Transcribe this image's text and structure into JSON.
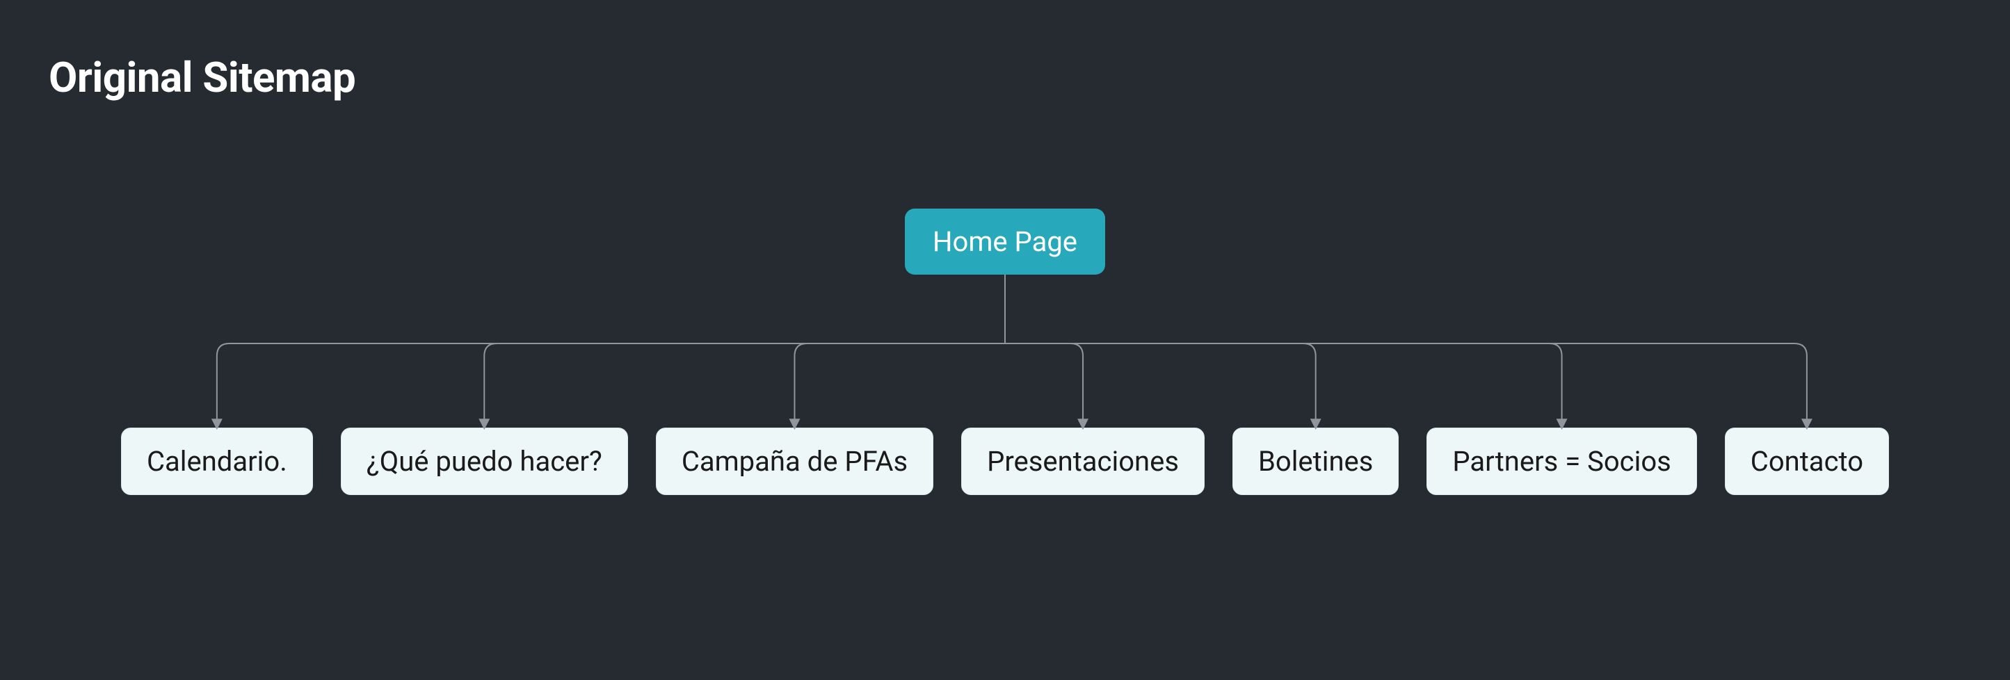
{
  "title": "Original Sitemap",
  "root": {
    "label": "Home Page"
  },
  "children": [
    {
      "label": "Calendario."
    },
    {
      "label": "¿Qué puedo hacer?"
    },
    {
      "label": "Campaña de PFAs"
    },
    {
      "label": "Presentaciones"
    },
    {
      "label": "Boletines"
    },
    {
      "label": "Partners = Socios"
    },
    {
      "label": "Contacto"
    }
  ],
  "colors": {
    "background": "#262b32",
    "root_fill": "#27a9bb",
    "root_text": "#ffffff",
    "child_fill": "#eef7f8",
    "child_text": "#1a1a1a",
    "connector": "#8f969d"
  }
}
